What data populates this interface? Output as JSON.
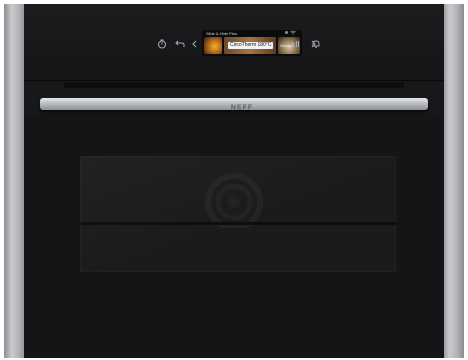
{
  "product": {
    "type": "built-in compact oven",
    "brand": "NEFF"
  },
  "display": {
    "title": "Slide & Hide Plus",
    "mode": "CircoTherm 180°C",
    "side_label": "Garmen",
    "wifi_label": "wifi-icon"
  },
  "controls": [
    {
      "id": "timer",
      "icon": "timer-icon"
    },
    {
      "id": "back",
      "icon": "back-arrow-icon"
    },
    {
      "id": "left",
      "icon": "chevron-left-icon"
    },
    {
      "id": "right",
      "icon": "chevron-right-icon"
    },
    {
      "id": "play_pause",
      "icon": "play-pause-icon"
    },
    {
      "id": "alarm",
      "icon": "bell-icon"
    }
  ],
  "colors": {
    "body": "#171819",
    "steel": "#c9cbce",
    "accent": "#f2b338"
  }
}
